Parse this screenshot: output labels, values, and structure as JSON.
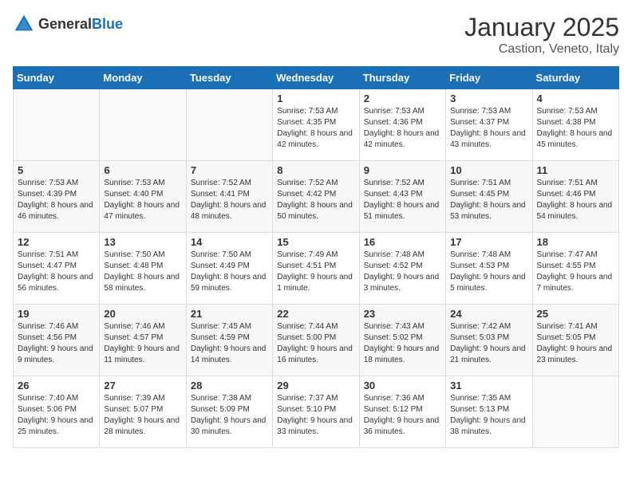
{
  "header": {
    "logo_general": "General",
    "logo_blue": "Blue",
    "month": "January 2025",
    "location": "Castion, Veneto, Italy"
  },
  "days_of_week": [
    "Sunday",
    "Monday",
    "Tuesday",
    "Wednesday",
    "Thursday",
    "Friday",
    "Saturday"
  ],
  "weeks": [
    [
      {
        "day": "",
        "info": ""
      },
      {
        "day": "",
        "info": ""
      },
      {
        "day": "",
        "info": ""
      },
      {
        "day": "1",
        "info": "Sunrise: 7:53 AM\nSunset: 4:35 PM\nDaylight: 8 hours and 42 minutes."
      },
      {
        "day": "2",
        "info": "Sunrise: 7:53 AM\nSunset: 4:36 PM\nDaylight: 8 hours and 42 minutes."
      },
      {
        "day": "3",
        "info": "Sunrise: 7:53 AM\nSunset: 4:37 PM\nDaylight: 8 hours and 43 minutes."
      },
      {
        "day": "4",
        "info": "Sunrise: 7:53 AM\nSunset: 4:38 PM\nDaylight: 8 hours and 45 minutes."
      }
    ],
    [
      {
        "day": "5",
        "info": "Sunrise: 7:53 AM\nSunset: 4:39 PM\nDaylight: 8 hours and 46 minutes."
      },
      {
        "day": "6",
        "info": "Sunrise: 7:53 AM\nSunset: 4:40 PM\nDaylight: 8 hours and 47 minutes."
      },
      {
        "day": "7",
        "info": "Sunrise: 7:52 AM\nSunset: 4:41 PM\nDaylight: 8 hours and 48 minutes."
      },
      {
        "day": "8",
        "info": "Sunrise: 7:52 AM\nSunset: 4:42 PM\nDaylight: 8 hours and 50 minutes."
      },
      {
        "day": "9",
        "info": "Sunrise: 7:52 AM\nSunset: 4:43 PM\nDaylight: 8 hours and 51 minutes."
      },
      {
        "day": "10",
        "info": "Sunrise: 7:51 AM\nSunset: 4:45 PM\nDaylight: 8 hours and 53 minutes."
      },
      {
        "day": "11",
        "info": "Sunrise: 7:51 AM\nSunset: 4:46 PM\nDaylight: 8 hours and 54 minutes."
      }
    ],
    [
      {
        "day": "12",
        "info": "Sunrise: 7:51 AM\nSunset: 4:47 PM\nDaylight: 8 hours and 56 minutes."
      },
      {
        "day": "13",
        "info": "Sunrise: 7:50 AM\nSunset: 4:48 PM\nDaylight: 8 hours and 58 minutes."
      },
      {
        "day": "14",
        "info": "Sunrise: 7:50 AM\nSunset: 4:49 PM\nDaylight: 8 hours and 59 minutes."
      },
      {
        "day": "15",
        "info": "Sunrise: 7:49 AM\nSunset: 4:51 PM\nDaylight: 9 hours and 1 minute."
      },
      {
        "day": "16",
        "info": "Sunrise: 7:48 AM\nSunset: 4:52 PM\nDaylight: 9 hours and 3 minutes."
      },
      {
        "day": "17",
        "info": "Sunrise: 7:48 AM\nSunset: 4:53 PM\nDaylight: 9 hours and 5 minutes."
      },
      {
        "day": "18",
        "info": "Sunrise: 7:47 AM\nSunset: 4:55 PM\nDaylight: 9 hours and 7 minutes."
      }
    ],
    [
      {
        "day": "19",
        "info": "Sunrise: 7:46 AM\nSunset: 4:56 PM\nDaylight: 9 hours and 9 minutes."
      },
      {
        "day": "20",
        "info": "Sunrise: 7:46 AM\nSunset: 4:57 PM\nDaylight: 9 hours and 11 minutes."
      },
      {
        "day": "21",
        "info": "Sunrise: 7:45 AM\nSunset: 4:59 PM\nDaylight: 9 hours and 14 minutes."
      },
      {
        "day": "22",
        "info": "Sunrise: 7:44 AM\nSunset: 5:00 PM\nDaylight: 9 hours and 16 minutes."
      },
      {
        "day": "23",
        "info": "Sunrise: 7:43 AM\nSunset: 5:02 PM\nDaylight: 9 hours and 18 minutes."
      },
      {
        "day": "24",
        "info": "Sunrise: 7:42 AM\nSunset: 5:03 PM\nDaylight: 9 hours and 21 minutes."
      },
      {
        "day": "25",
        "info": "Sunrise: 7:41 AM\nSunset: 5:05 PM\nDaylight: 9 hours and 23 minutes."
      }
    ],
    [
      {
        "day": "26",
        "info": "Sunrise: 7:40 AM\nSunset: 5:06 PM\nDaylight: 9 hours and 25 minutes."
      },
      {
        "day": "27",
        "info": "Sunrise: 7:39 AM\nSunset: 5:07 PM\nDaylight: 9 hours and 28 minutes."
      },
      {
        "day": "28",
        "info": "Sunrise: 7:38 AM\nSunset: 5:09 PM\nDaylight: 9 hours and 30 minutes."
      },
      {
        "day": "29",
        "info": "Sunrise: 7:37 AM\nSunset: 5:10 PM\nDaylight: 9 hours and 33 minutes."
      },
      {
        "day": "30",
        "info": "Sunrise: 7:36 AM\nSunset: 5:12 PM\nDaylight: 9 hours and 36 minutes."
      },
      {
        "day": "31",
        "info": "Sunrise: 7:35 AM\nSunset: 5:13 PM\nDaylight: 9 hours and 38 minutes."
      },
      {
        "day": "",
        "info": ""
      }
    ]
  ]
}
